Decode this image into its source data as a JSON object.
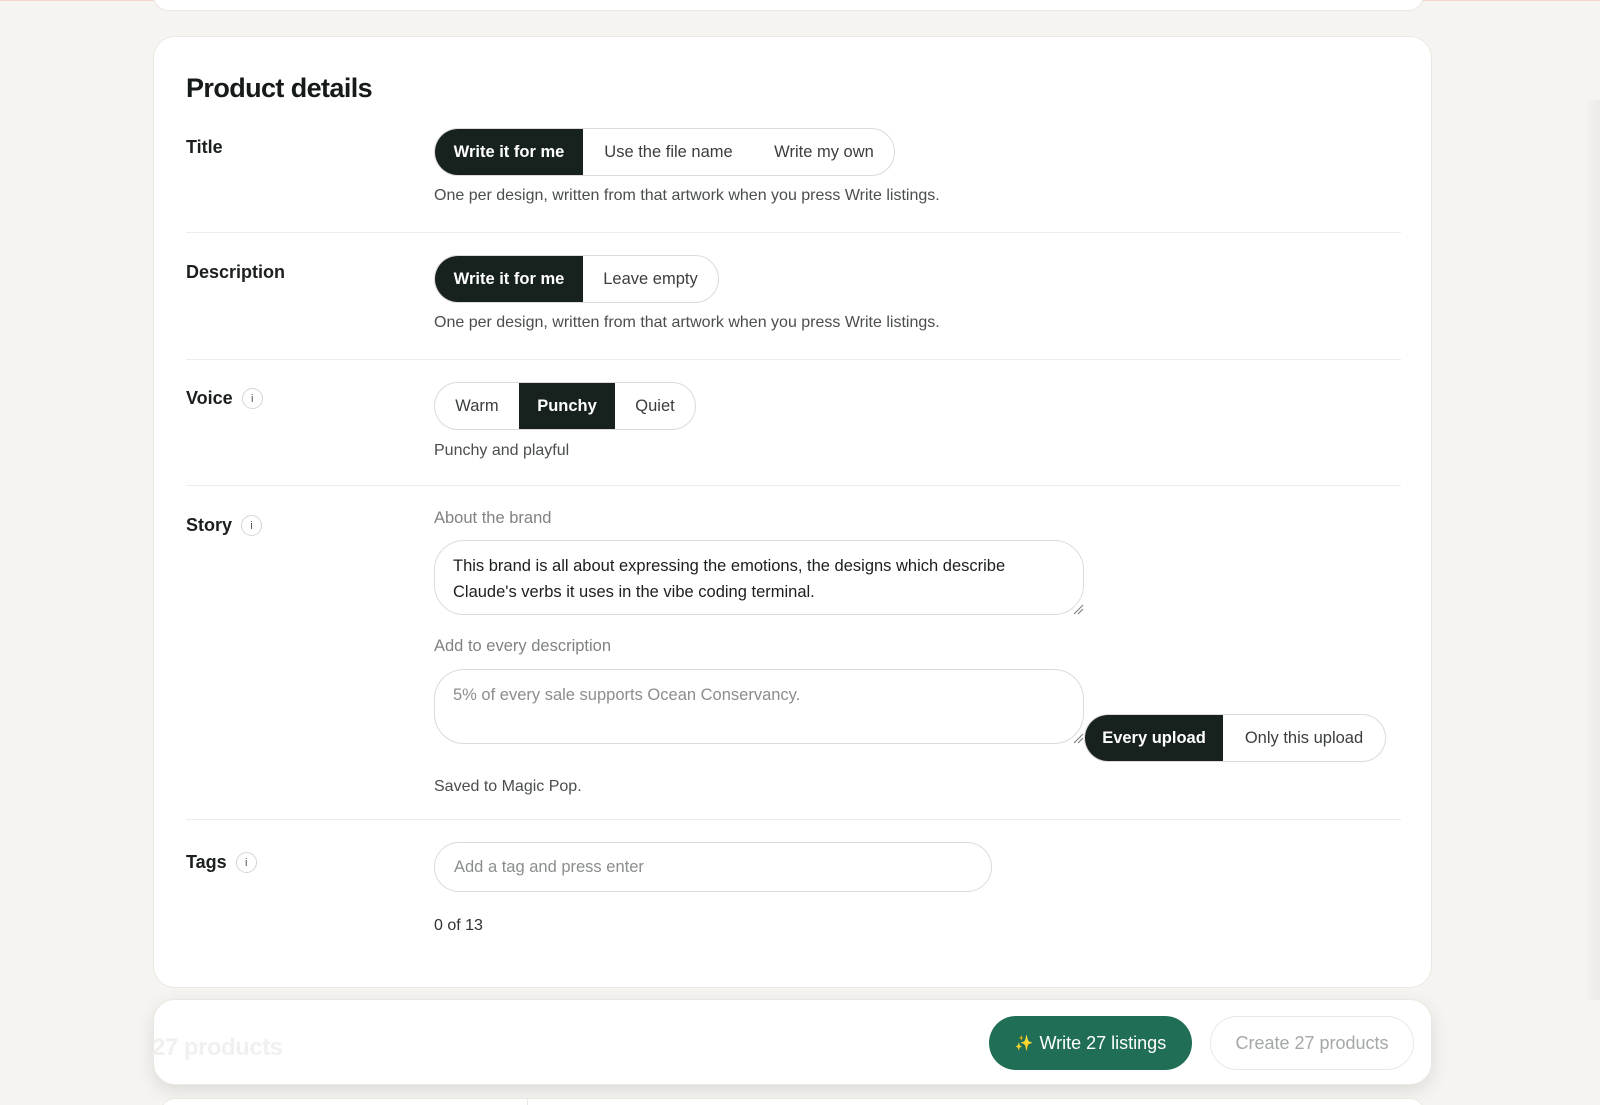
{
  "section_title": "Product details",
  "title_row": {
    "label": "Title",
    "options": [
      "Write it for me",
      "Use the file name",
      "Write my own"
    ],
    "selected": "Write it for me",
    "hint": "One per design, written from that artwork when you press Write listings."
  },
  "description_row": {
    "label": "Description",
    "options": [
      "Write it for me",
      "Leave empty"
    ],
    "selected": "Write it for me",
    "hint": "One per design, written from that artwork when you press Write listings."
  },
  "voice_row": {
    "label": "Voice",
    "info_icon": "i",
    "options": [
      "Warm",
      "Punchy",
      "Quiet"
    ],
    "selected": "Punchy",
    "hint": "Punchy and playful"
  },
  "story_row": {
    "label": "Story",
    "info_icon": "i",
    "about_label": "About the brand",
    "about_value": "This brand is all about expressing the emotions, the designs which describe Claude's verbs it uses in the vibe coding terminal.",
    "add_label": "Add to every description",
    "add_placeholder": "5% of every sale supports Ocean Conservancy.",
    "scope_options": [
      "Every upload",
      "Only this upload"
    ],
    "scope_selected": "Every upload",
    "saved_note": "Saved to Magic Pop."
  },
  "tags_row": {
    "label": "Tags",
    "info_icon": "i",
    "placeholder": "Add a tag and press enter",
    "count": "0 of 13"
  },
  "action_bar": {
    "ghost_count": "27 products",
    "primary_icon": "✨",
    "primary_label": "Write 27 listings",
    "secondary_label": "Create 27 products"
  },
  "colors": {
    "selected_segment": "#17211d",
    "primary_button": "#1f6e55",
    "background": "#f6f4f1"
  }
}
